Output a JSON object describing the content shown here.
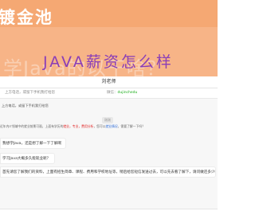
{
  "banner": {
    "logo": "镀金池",
    "bg_headline": "学Java的以干啥？",
    "headline": "JAVA薪资怎么样"
  },
  "chat": {
    "title": "刘老师",
    "phone_label": "上方电话，或留下手机我打给您",
    "wechat_label": "微信：",
    "wechat_value": "dujinchedu",
    "tip": "上方电话，或留下手机我打给您",
    "timestamp": "刚刚",
    "system_message": {
      "prefix": "近年内IT领域中的就业前景可观，上面有学历的",
      "red1": "就业，专业，费用分析",
      "middle": "，您可以",
      "blue1": "就业情况",
      "suffix": "，需要了解一下吗？"
    },
    "messages": [
      "我想学Java，还是想了解一下了解啊",
      "学习Java大概多久能就业呢？",
      "首先请您了解我们的资料，上面有招生简章、课程、费用和学校地址等，稍后给您短信发送过去，可以先去看了解下，请问做还多少呢？"
    ]
  }
}
